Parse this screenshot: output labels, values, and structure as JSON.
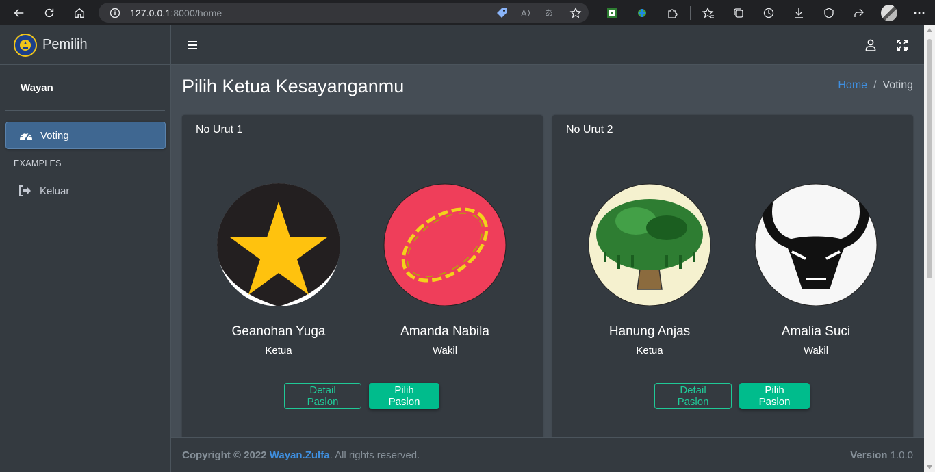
{
  "browser": {
    "url_host": "127.0.0.1",
    "url_path": ":8000/home"
  },
  "sidebar": {
    "brand": "Pemilih",
    "user": "Wayan",
    "items": [
      {
        "label": "Voting",
        "icon": "tachometer-icon",
        "active": true
      },
      {
        "label": "Keluar",
        "icon": "sign-out-icon",
        "active": false
      }
    ],
    "header": "EXAMPLES"
  },
  "page": {
    "title": "Pilih Ketua Kesayanganmu",
    "breadcrumb_home": "Home",
    "breadcrumb_sep": "/",
    "breadcrumb_current": "Voting"
  },
  "cards": [
    {
      "header": "No Urut 1",
      "ketua": {
        "name": "Geanohan Yuga",
        "role": "Ketua",
        "image": "star-emblem"
      },
      "wakil": {
        "name": "Amanda Nabila",
        "role": "Wakil",
        "image": "chain-emblem"
      },
      "detail_label": "Detail Paslon",
      "pilih_label": "Pilih Paslon"
    },
    {
      "header": "No Urut 2",
      "ketua": {
        "name": "Hanung Anjas",
        "role": "Ketua",
        "image": "banyan-tree-emblem"
      },
      "wakil": {
        "name": "Amalia Suci",
        "role": "Wakil",
        "image": "bull-head-emblem"
      },
      "detail_label": "Detail Paslon",
      "pilih_label": "Pilih Paslon"
    }
  ],
  "footer": {
    "copyright": "Copyright © 2022",
    "author": "Wayan.Zulfa",
    "rights": ". All rights reserved.",
    "version_label": "Version",
    "version": "1.0.0"
  },
  "colors": {
    "accent": "#00bc8c",
    "link": "#3f8fe0",
    "active_nav": "#3f6791"
  }
}
